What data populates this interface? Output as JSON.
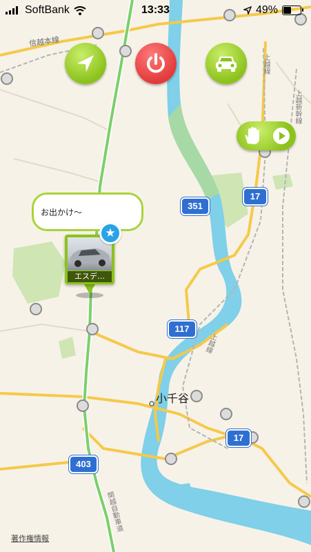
{
  "status_bar": {
    "carrier": "SoftBank",
    "time": "13:33",
    "battery_percent": "49%"
  },
  "controls": {
    "locate_icon": "navigation-arrow-icon",
    "power_icon": "power-icon",
    "car_icon": "car-icon",
    "hand_icon": "hand-icon",
    "play_icon": "play-icon"
  },
  "pin": {
    "message": "お出かけ～",
    "car_name": "エスデ…",
    "badge_icon": "star-icon"
  },
  "map": {
    "routes": [
      "351",
      "17",
      "117",
      "17",
      "403"
    ],
    "town": "小千谷",
    "rail_lines": [
      "信越本線",
      "上越線",
      "上越線",
      "上越新幹線",
      "関越自動車道"
    ],
    "copyright": "著作権情報"
  },
  "colors": {
    "button_green": "#8cc21c",
    "button_red": "#e23b3b",
    "river": "#7fd0e8",
    "highway": "#7ccf6b",
    "road": "#f5c94a",
    "route_shield": "#2f6fd1",
    "badge_blue": "#29a3e6"
  }
}
